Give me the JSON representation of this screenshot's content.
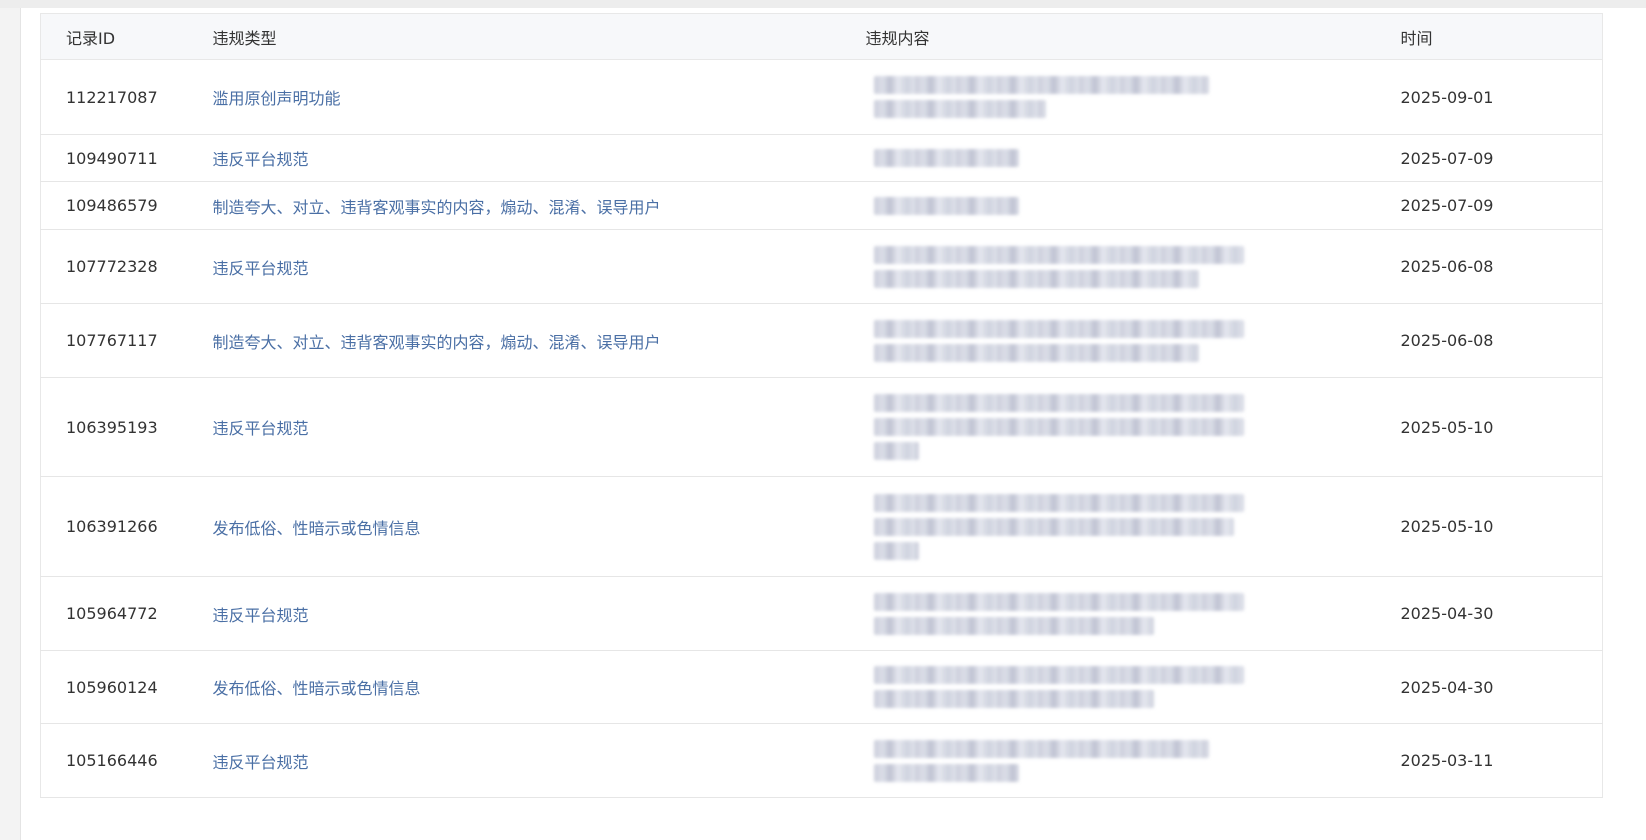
{
  "table": {
    "headers": {
      "id": "记录ID",
      "type": "违规类型",
      "content": "违规内容",
      "time": "时间"
    },
    "rows": [
      {
        "id": "112217087",
        "type": "滥用原创声明功能",
        "time": "2025-09-01"
      },
      {
        "id": "109490711",
        "type": "违反平台规范",
        "time": "2025-07-09"
      },
      {
        "id": "109486579",
        "type": "制造夸大、对立、违背客观事实的内容，煽动、混淆、误导用户",
        "time": "2025-07-09"
      },
      {
        "id": "107772328",
        "type": "违反平台规范",
        "time": "2025-06-08"
      },
      {
        "id": "107767117",
        "type": "制造夸大、对立、违背客观事实的内容，煽动、混淆、误导用户",
        "time": "2025-06-08"
      },
      {
        "id": "106395193",
        "type": "违反平台规范",
        "time": "2025-05-10"
      },
      {
        "id": "106391266",
        "type": "发布低俗、性暗示或色情信息",
        "time": "2025-05-10"
      },
      {
        "id": "105964772",
        "type": "违反平台规范",
        "time": "2025-04-30"
      },
      {
        "id": "105960124",
        "type": "发布低俗、性暗示或色情信息",
        "time": "2025-04-30"
      },
      {
        "id": "105166446",
        "type": "违反平台规范",
        "time": "2025-03-11"
      }
    ]
  },
  "colors": {
    "link": "#4a6fa5",
    "text": "#333333",
    "header_bg": "#f7f8fa",
    "border": "#e6e6e6"
  }
}
